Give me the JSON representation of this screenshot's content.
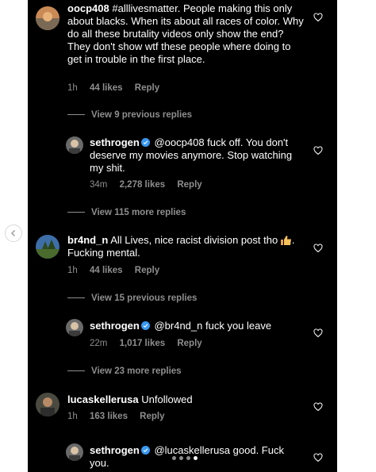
{
  "comments": [
    {
      "username": "oocp408",
      "text": "#alllivesmatter.  People making this only about blacks. When its about all races of color. Why do all these brutality videos only show the end? They don't show wtf these people where doing to get in trouble in the first place.",
      "time": "1h",
      "likes": "44 likes",
      "reply": "Reply",
      "view_replies": "View 9 previous replies"
    },
    {
      "username": "sethrogen",
      "text": "@oocp408 fuck off. You don't deserve my movies anymore. Stop watching my shit.",
      "time": "34m",
      "likes": "2,278 likes",
      "reply": "Reply",
      "view_replies": "View 115 more replies"
    },
    {
      "username": "br4nd_n",
      "text": "All Lives, nice racist division post tho",
      "text_after_emoji": ". Fucking mental.",
      "emoji": "thumbs-up-icon",
      "time": "1h",
      "likes": "44 likes",
      "reply": "Reply",
      "view_replies": "View 15 previous replies"
    },
    {
      "username": "sethrogen",
      "text": "@br4nd_n fuck you leave",
      "time": "22m",
      "likes": "1,017 likes",
      "reply": "Reply",
      "view_replies": "View 23 more replies"
    },
    {
      "username": "lucaskellerusa",
      "text": "Unfollowed",
      "time": "1h",
      "likes": "163 likes",
      "reply": "Reply"
    },
    {
      "username": "sethrogen",
      "text": "@lucaskellerusa good. Fuck you."
    }
  ],
  "colors": {
    "background": "#000000",
    "text": "#ffffff",
    "meta": "#8e8e8e",
    "verified": "#3897f0"
  }
}
